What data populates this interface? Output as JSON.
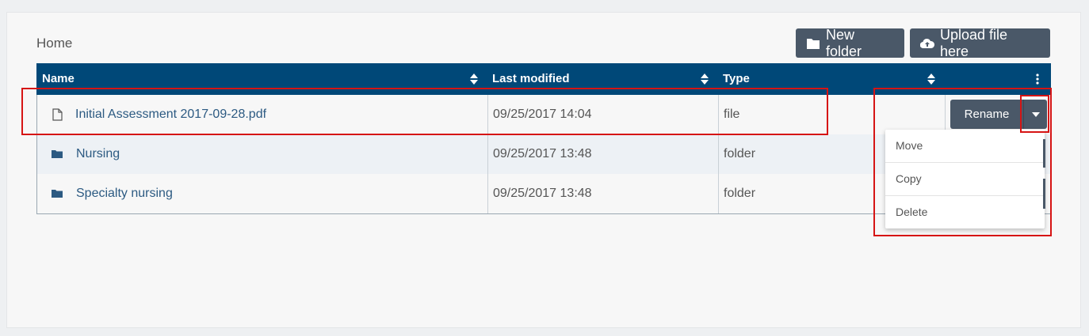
{
  "breadcrumb": "Home",
  "toolbar": {
    "new_folder_label": "New folder",
    "upload_label": "Upload file here"
  },
  "table": {
    "columns": [
      "Name",
      "Last modified",
      "Type"
    ],
    "rows": [
      {
        "name": "Initial Assessment 2017-09-28.pdf",
        "modified": "09/25/2017 14:04",
        "type": "file",
        "icon": "file-icon"
      },
      {
        "name": "Nursing",
        "modified": "09/25/2017 13:48",
        "type": "folder",
        "icon": "folder-icon"
      },
      {
        "name": "Specialty nursing",
        "modified": "09/25/2017 13:48",
        "type": "folder",
        "icon": "folder-icon"
      }
    ]
  },
  "actions": {
    "rename_label": "Rename",
    "menu": [
      "Move",
      "Copy",
      "Delete"
    ]
  },
  "colors": {
    "header_bg": "#004878",
    "button_bg": "#4a5868",
    "link_text": "#2c5a82",
    "highlight": "#d61414"
  }
}
